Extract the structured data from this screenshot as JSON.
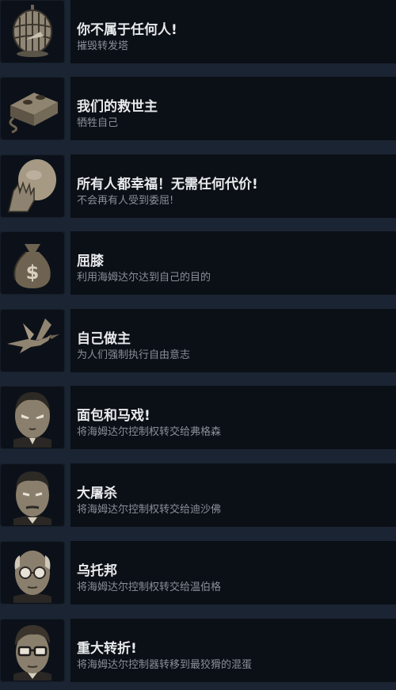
{
  "achievements": [
    {
      "title": "你不属于任何人!",
      "desc": "摧毁转发塔",
      "icon": "birdcage-icon"
    },
    {
      "title": "我们的救世主",
      "desc": "牺牲自己",
      "icon": "brick-icon"
    },
    {
      "title": "所有人都幸福！无需任何代价!",
      "desc": "不会再有人受到委屈!",
      "icon": "facepalm-icon"
    },
    {
      "title": "屈膝",
      "desc": "利用海姆达尔达到自己的目的",
      "icon": "money-bag-icon"
    },
    {
      "title": "自己做主",
      "desc": "为人们强制执行自由意志",
      "icon": "bird-icon"
    },
    {
      "title": "面包和马戏!",
      "desc": "将海姆达尔控制权转交给弗格森",
      "icon": "ferguson-portrait-icon"
    },
    {
      "title": "大屠杀",
      "desc": "将海姆达尔控制权转交给迪沙佛",
      "icon": "deshaw-portrait-icon"
    },
    {
      "title": "乌托邦",
      "desc": "将海姆达尔控制权转交给温伯格",
      "icon": "weinberg-portrait-icon"
    },
    {
      "title": "重大转折!",
      "desc": "将海姆达尔控制器转移到最狡猾的混蛋",
      "icon": "glasses-man-portrait-icon"
    }
  ]
}
